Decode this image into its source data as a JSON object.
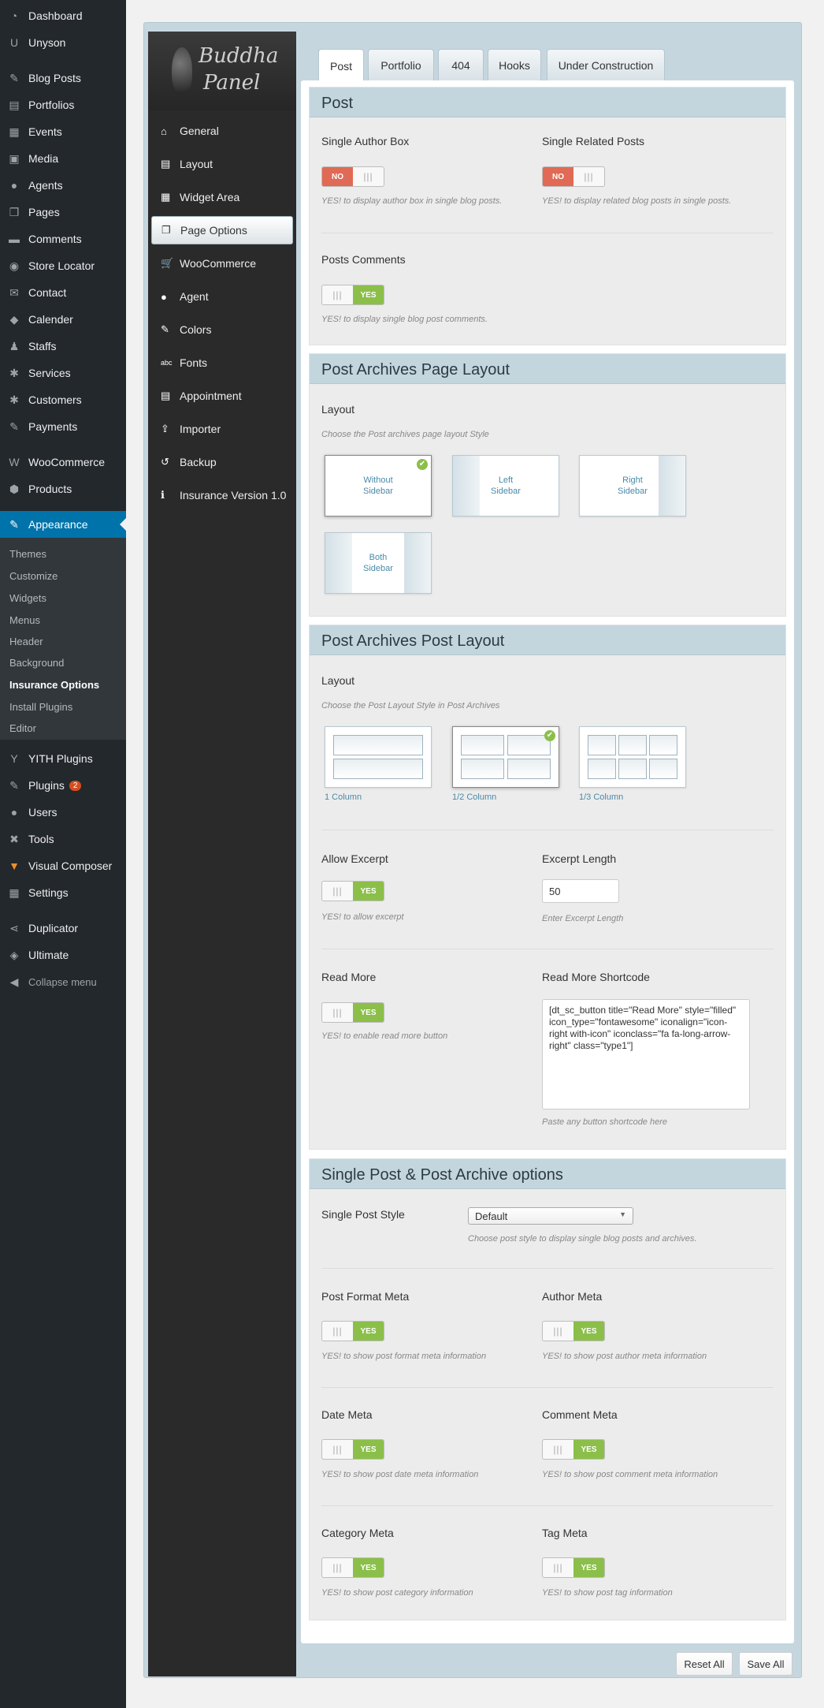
{
  "wp_menu": {
    "top": [
      {
        "label": "Dashboard",
        "icon": "dashboard-icon",
        "glyph": "◔"
      },
      {
        "label": "Unyson",
        "icon": "unyson-icon",
        "glyph": "U"
      }
    ],
    "content": [
      {
        "label": "Blog Posts",
        "icon": "pin-icon",
        "glyph": "✎"
      },
      {
        "label": "Portfolios",
        "icon": "portfolio-icon",
        "glyph": "▤"
      },
      {
        "label": "Events",
        "icon": "calendar-icon",
        "glyph": "▦"
      },
      {
        "label": "Media",
        "icon": "media-icon",
        "glyph": "▣"
      },
      {
        "label": "Agents",
        "icon": "user-icon",
        "glyph": "●"
      },
      {
        "label": "Pages",
        "icon": "pages-icon",
        "glyph": "❐"
      },
      {
        "label": "Comments",
        "icon": "comment-icon",
        "glyph": "▬"
      },
      {
        "label": "Store Locator",
        "icon": "location-icon",
        "glyph": "◉"
      },
      {
        "label": "Contact",
        "icon": "mail-icon",
        "glyph": "✉"
      },
      {
        "label": "Calender",
        "icon": "tag-icon",
        "glyph": "◆"
      },
      {
        "label": "Staffs",
        "icon": "staff-icon",
        "glyph": "♟"
      },
      {
        "label": "Services",
        "icon": "services-icon",
        "glyph": "✱"
      },
      {
        "label": "Customers",
        "icon": "customers-icon",
        "glyph": "✱"
      },
      {
        "label": "Payments",
        "icon": "payments-icon",
        "glyph": "✎"
      }
    ],
    "shop": [
      {
        "label": "WooCommerce",
        "icon": "woocommerce-icon",
        "glyph": "W"
      },
      {
        "label": "Products",
        "icon": "products-icon",
        "glyph": "⬢"
      }
    ],
    "appearance": {
      "label": "Appearance",
      "icon": "appearance-icon",
      "glyph": "✎"
    },
    "submenu": [
      "Themes",
      "Customize",
      "Widgets",
      "Menus",
      "Header",
      "Background",
      "Insurance Options",
      "Install Plugins",
      "Editor"
    ],
    "bottom": [
      {
        "label": "YITH Plugins",
        "icon": "yith-icon",
        "glyph": "Y"
      },
      {
        "label": "Plugins",
        "icon": "plugins-icon",
        "glyph": "✎",
        "badge": "2"
      },
      {
        "label": "Users",
        "icon": "users-icon",
        "glyph": "●"
      },
      {
        "label": "Tools",
        "icon": "tools-icon",
        "glyph": "✖"
      },
      {
        "label": "Visual Composer",
        "icon": "visual-composer-icon",
        "glyph": "▼"
      },
      {
        "label": "Settings",
        "icon": "settings-icon",
        "glyph": "▦"
      }
    ],
    "extra": [
      {
        "label": "Duplicator",
        "icon": "share-icon",
        "glyph": "⋖"
      },
      {
        "label": "Ultimate",
        "icon": "shield-icon",
        "glyph": "◈"
      }
    ],
    "collapse": "Collapse menu"
  },
  "panel": {
    "logo_line1": "Buddha",
    "logo_line2": "Panel",
    "nav": [
      {
        "label": "General",
        "icon": "home-icon",
        "glyph": "⌂"
      },
      {
        "label": "Layout",
        "icon": "layout-icon",
        "glyph": "▤"
      },
      {
        "label": "Widget Area",
        "icon": "widget-icon",
        "glyph": "▦"
      },
      {
        "label": "Page Options",
        "icon": "page-icon",
        "glyph": "❐"
      },
      {
        "label": "WooCommerce",
        "icon": "cart-icon",
        "glyph": "🛒"
      },
      {
        "label": "Agent",
        "icon": "agent-icon",
        "glyph": "●"
      },
      {
        "label": "Colors",
        "icon": "brush-icon",
        "glyph": "✎"
      },
      {
        "label": "Fonts",
        "icon": "fonts-icon",
        "glyph": "abc"
      },
      {
        "label": "Appointment",
        "icon": "appointment-icon",
        "glyph": "▤"
      },
      {
        "label": "Importer",
        "icon": "upload-icon",
        "glyph": "⇪"
      },
      {
        "label": "Backup",
        "icon": "backup-icon",
        "glyph": "↺"
      },
      {
        "label": "Insurance Version 1.0",
        "icon": "info-icon",
        "glyph": "ℹ"
      }
    ]
  },
  "tabs": [
    "Post",
    "Portfolio",
    "404",
    "Hooks",
    "Under Construction"
  ],
  "post": {
    "title": "Post",
    "author_box": {
      "label": "Single Author Box",
      "state": "NO",
      "hint": "YES! to display author box in single blog posts."
    },
    "related": {
      "label": "Single Related Posts",
      "state": "NO",
      "hint": "YES! to display related blog posts in single posts."
    },
    "comments": {
      "label": "Posts Comments",
      "state": "YES",
      "hint": "YES! to display single blog post comments."
    }
  },
  "archives_page": {
    "title": "Post Archives Page Layout",
    "label": "Layout",
    "hint": "Choose the Post archives page layout Style",
    "options": [
      {
        "line1": "Without",
        "line2": "Sidebar"
      },
      {
        "line1": "Left",
        "line2": "Sidebar"
      },
      {
        "line1": "Right",
        "line2": "Sidebar"
      },
      {
        "line1": "Both",
        "line2": "Sidebar"
      }
    ]
  },
  "archives_post": {
    "title": "Post Archives Post Layout",
    "label": "Layout",
    "hint": "Choose the Post Layout Style in Post Archives",
    "options": [
      "1 Column",
      "1/2 Column",
      "1/3 Column"
    ],
    "allow_excerpt": {
      "label": "Allow Excerpt",
      "state": "YES",
      "hint": "YES! to allow excerpt"
    },
    "excerpt_length": {
      "label": "Excerpt Length",
      "value": "50",
      "hint": "Enter Excerpt Length"
    },
    "read_more": {
      "label": "Read More",
      "state": "YES",
      "hint": "YES! to enable read more button"
    },
    "shortcode": {
      "label": "Read More Shortcode",
      "value": "[dt_sc_button title=\"Read More\" style=\"filled\" icon_type=\"fontawesome\" iconalign=\"icon-right with-icon\" iconclass=\"fa fa-long-arrow-right\" class=\"type1\"]",
      "hint": "Paste any button shortcode here"
    }
  },
  "single": {
    "title": "Single Post & Post Archive options",
    "style": {
      "label": "Single Post Style",
      "value": "Default",
      "hint": "Choose post style to display single blog posts and archives."
    },
    "metas": [
      {
        "label": "Post Format Meta",
        "state": "YES",
        "hint": "YES! to show post format meta information"
      },
      {
        "label": "Author Meta",
        "state": "YES",
        "hint": "YES! to show post author meta information"
      },
      {
        "label": "Date Meta",
        "state": "YES",
        "hint": "YES! to show post date meta information"
      },
      {
        "label": "Comment Meta",
        "state": "YES",
        "hint": "YES! to show post comment meta information"
      },
      {
        "label": "Category Meta",
        "state": "YES",
        "hint": "YES! to show post category information"
      },
      {
        "label": "Tag Meta",
        "state": "YES",
        "hint": "YES! to show post tag information"
      }
    ]
  },
  "buttons": {
    "reset": "Reset All",
    "save": "Save All"
  },
  "colors": {
    "wp_sidebar": "#23282d",
    "wp_active": "#0073aa",
    "yes": "#8bbf4a",
    "no": "#e06a55",
    "section_head": "#c3d6de"
  }
}
